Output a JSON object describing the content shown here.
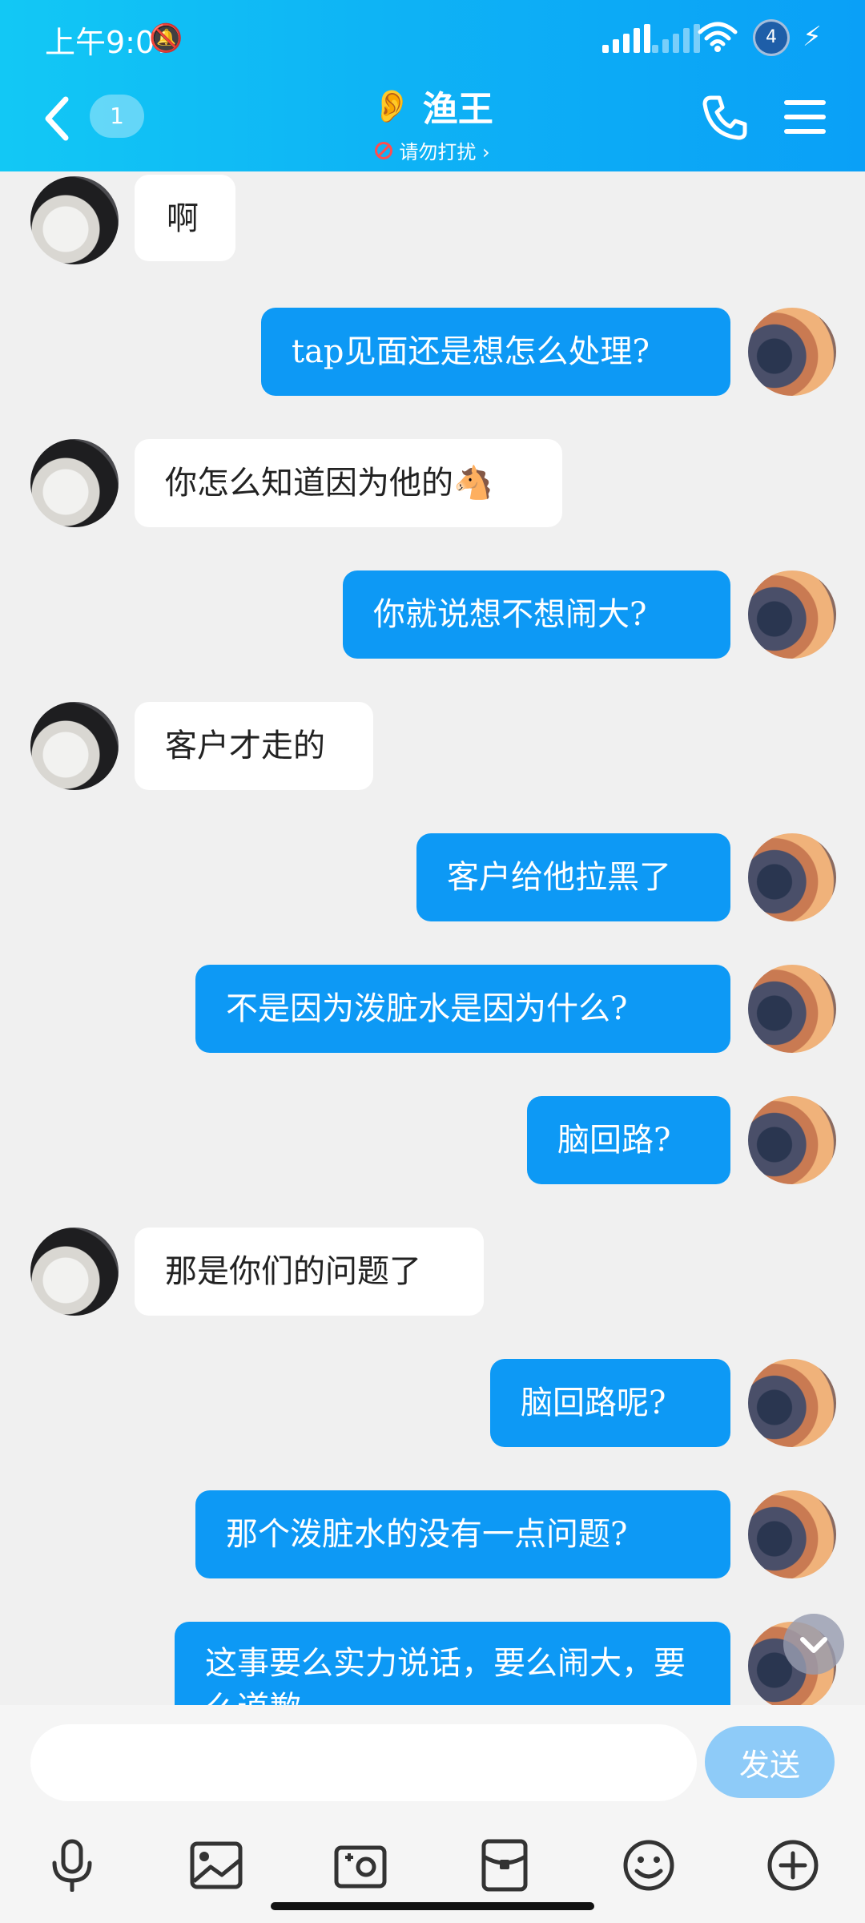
{
  "status_bar": {
    "time": "上午9:07",
    "battery_label": "4"
  },
  "header": {
    "unread_count": "1",
    "contact_name": "渔王",
    "status_text": "请勿打扰 ›"
  },
  "messages": [
    {
      "side": "peer",
      "text": "啊"
    },
    {
      "side": "self",
      "text": "tap见面还是想怎么处理?"
    },
    {
      "side": "peer",
      "text": "你怎么知道因为他的🐴"
    },
    {
      "side": "self",
      "text": "你就说想不想闹大?"
    },
    {
      "side": "peer",
      "text": "客户才走的"
    },
    {
      "side": "self",
      "text": "客户给他拉黑了"
    },
    {
      "side": "self",
      "text": "不是因为泼脏水是因为什么?"
    },
    {
      "side": "self",
      "text": "脑回路?"
    },
    {
      "side": "peer",
      "text": "那是你们的问题了"
    },
    {
      "side": "self",
      "text": "脑回路呢?"
    },
    {
      "side": "self",
      "text": "那个泼脏水的没有一点问题?"
    },
    {
      "side": "self",
      "text": "这事要么实力说话，要么闹大，要么道歉"
    }
  ],
  "input": {
    "placeholder": "",
    "send_label": "发送"
  },
  "toolbar": {
    "icons": [
      "microphone-icon",
      "image-icon",
      "camera-icon",
      "red-packet-icon",
      "emoji-icon",
      "plus-icon"
    ]
  },
  "colors": {
    "header_start": "#12c8f5",
    "header_end": "#0aa0f7",
    "self_bubble": "#0d99f5",
    "peer_bubble": "#ffffff",
    "send_button": "#8ecbf8",
    "chat_background": "#f0f0f0"
  }
}
